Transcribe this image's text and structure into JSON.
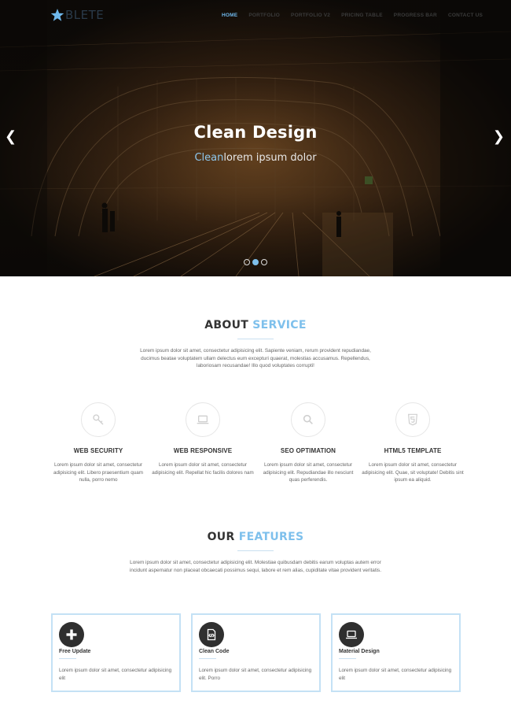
{
  "nav": {
    "logo_text": "BLETE",
    "items": [
      {
        "label": "HOME",
        "active": true
      },
      {
        "label": "PORTFOLIO",
        "active": false
      },
      {
        "label": "PORTFOLIO V2",
        "active": false
      },
      {
        "label": "PRICING TABLE",
        "active": false
      },
      {
        "label": "PROGRESS BAR",
        "active": false
      },
      {
        "label": "CONTACT US",
        "active": false
      }
    ]
  },
  "hero": {
    "title": "Clean Design",
    "subtitle_accent": "Clean",
    "subtitle_rest": "lorem ipsum dolor",
    "prev_icon": "chevron-left-icon",
    "next_icon": "chevron-right-icon",
    "slides_count": 3,
    "active_slide": 2
  },
  "about": {
    "title_dark": "ABOUT",
    "title_accent": "SERVICE",
    "text": "Lorem ipsum dolor sit amet, consectetur adipisicing elit. Sapiente veniam, rerum provident repudiandae, ducimus beatae voluptatem ullam delectus eum excepturi quaerat, molestias accusamus. Repellendus, laboriosam recusandae! Illo quod voluptates corrupti!"
  },
  "services": [
    {
      "icon": "key-icon",
      "title": "WEB SECURITY",
      "text": "Lorem ipsum dolor sit amet, consectetur adipisicing elit. Libero praesentium quam nulla, porro nemo"
    },
    {
      "icon": "laptop-icon",
      "title": "WEB RESPONSIVE",
      "text": "Lorem ipsum dolor sit amet, consectetur adipisicing elit. Repellat hic facilis dolores nam"
    },
    {
      "icon": "search-icon",
      "title": "SEO OPTIMATION",
      "text": "Lorem ipsum dolor sit amet, consectetur adipisicing elit. Repudiandae illo nesciunt quas perferendis."
    },
    {
      "icon": "html5-icon",
      "title": "HTML5 TEMPLATE",
      "text": "Lorem ipsum dolor sit amet, consectetur adipisicing elit. Quae, sit voluptate! Debitis sint ipsum ea aliquid."
    }
  ],
  "features_section": {
    "title_dark": "OUR",
    "title_accent": "FEATURES",
    "text": "Lorem ipsum dolor sit amet, consectetur adipisicing elit. Molestiae quibusdam debitis earum voluptas autem error incidunt aspernatur non placeat obcaecati possimus sequi, labore et rem alias, cupiditate vitae provident veritatis."
  },
  "features": [
    {
      "icon": "plus-icon",
      "title": "Free Update",
      "text": "Lorem ipsum dolor sit amet, consectetur adipisicing elit"
    },
    {
      "icon": "code-file-icon",
      "title": "Clean Code",
      "text": "Lorem ipsum dolor sit amet, consectetur adipisicing elit. Porro"
    },
    {
      "icon": "laptop-icon",
      "title": "Material Design",
      "text": "Lorem ipsum dolor sit amet, consectetur adipisicing elit"
    }
  ],
  "colors": {
    "accent": "#7ec0ec",
    "feature_border": "#c4e1f5",
    "icon_dark": "#2f2f2f"
  }
}
